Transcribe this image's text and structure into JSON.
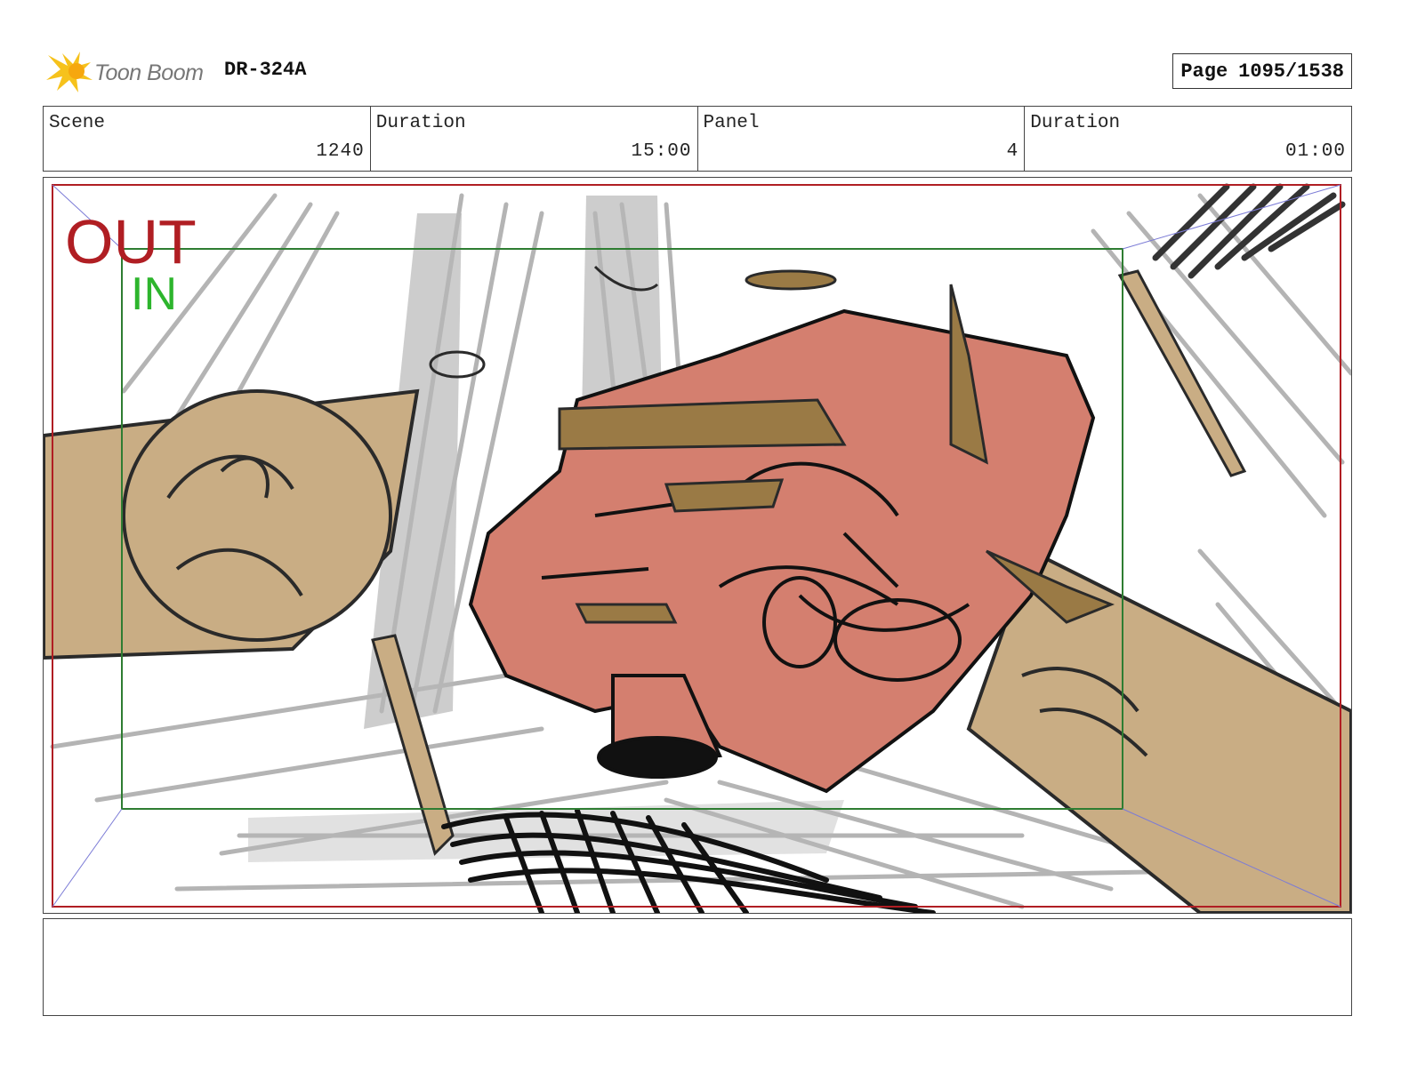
{
  "header": {
    "logo_text": "Toon Boom",
    "doc_id": "DR-324A",
    "page_label": "Page",
    "page_value": "1095/1538"
  },
  "info": {
    "scene_label": "Scene",
    "scene_value": "1240",
    "duration_label": "Duration",
    "duration_value": "15:00",
    "panel_label": "Panel",
    "panel_value": "4",
    "panel_duration_label": "Duration",
    "panel_duration_value": "01:00"
  },
  "panel": {
    "out_label": "OUT",
    "in_label": "IN",
    "colors": {
      "out_frame": "#b01e23",
      "in_frame": "#2e7d32",
      "skin": "#c9ad84",
      "hair": "#d47f6f",
      "prop": "#9a7a45",
      "sketch": "#9a9a9a"
    }
  },
  "notes": {
    "text": ""
  }
}
